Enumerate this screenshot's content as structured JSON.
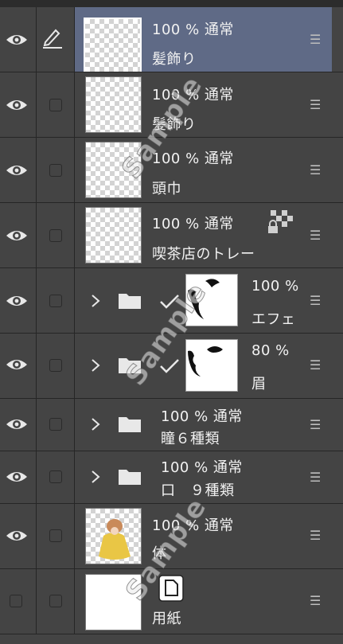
{
  "watermark": "Sample",
  "layers": [
    {
      "opacity": "100 %",
      "blend": "通常",
      "name": "髪飾り",
      "visible": true,
      "selected": true
    },
    {
      "opacity": "100 %",
      "blend": "通常",
      "name": "髪飾り",
      "visible": true
    },
    {
      "opacity": "100 %",
      "blend": "通常",
      "name": "頭巾",
      "visible": true
    },
    {
      "opacity": "100 %",
      "blend": "通常",
      "name": "喫茶店のトレー",
      "visible": true,
      "locked": true
    },
    {
      "opacity": "100 %",
      "name": "エフェク",
      "visible": true,
      "type": "folder-with-mask",
      "expanded": false
    },
    {
      "opacity": "80 %",
      "name": "眉",
      "visible": true,
      "type": "folder-with-mask",
      "expanded": false
    },
    {
      "opacity": "100 %",
      "blend": "通常",
      "name": "瞳６種類",
      "visible": true,
      "type": "folder"
    },
    {
      "opacity": "100 %",
      "blend": "通常",
      "name": "口　９種類",
      "visible": true,
      "type": "folder"
    },
    {
      "opacity": "100 %",
      "blend": "通常",
      "name": "体",
      "visible": true
    },
    {
      "name": "用紙",
      "visible": false,
      "type": "paper"
    }
  ],
  "icons": {
    "visibility": "eye-icon",
    "edit": "pen-icon",
    "menu": "drag-handle-icon",
    "folder": "folder-icon",
    "expand": "chevron-right-icon",
    "mask_link": "check-icon",
    "lock": "lock-transparent-icon",
    "paper": "paper-icon"
  },
  "colors": {
    "panel": "#444444",
    "selected": "#5f6a86",
    "separator": "#262626"
  }
}
